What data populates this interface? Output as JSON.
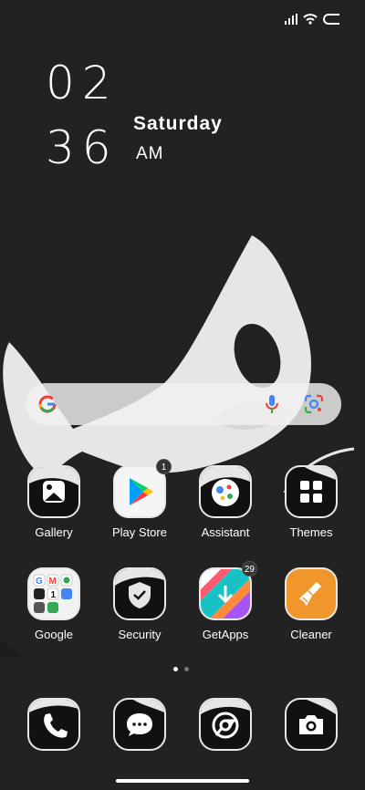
{
  "clock": {
    "hour": "02",
    "minute": "36",
    "day": "Saturday",
    "ampm": "AM"
  },
  "status_icons": [
    "signal-icon",
    "wifi-icon",
    "battery-icon"
  ],
  "search": {
    "icons": [
      "google-g-icon",
      "microphone-icon",
      "google-lens-icon"
    ]
  },
  "apps_row1": [
    {
      "label": "Gallery",
      "icon": "gallery-icon"
    },
    {
      "label": "Play Store",
      "icon": "play-store-icon",
      "badge": "1"
    },
    {
      "label": "Assistant",
      "icon": "assistant-icon"
    },
    {
      "label": "Themes",
      "icon": "themes-icon"
    }
  ],
  "apps_row2": [
    {
      "label": "Google",
      "icon": "google-folder-icon"
    },
    {
      "label": "Security",
      "icon": "shield-icon"
    },
    {
      "label": "GetApps",
      "icon": "getapps-icon",
      "badge": "29"
    },
    {
      "label": "Cleaner",
      "icon": "broom-icon"
    }
  ],
  "dock": [
    {
      "icon": "phone-icon"
    },
    {
      "icon": "messages-icon"
    },
    {
      "icon": "chrome-icon"
    },
    {
      "icon": "camera-icon"
    }
  ],
  "page_indicator": {
    "count": 2,
    "active": 1
  },
  "colors": {
    "background": "#222222",
    "wallpaper_shape": "#e6e6e6",
    "cleaner_accent": "#f0962a"
  }
}
